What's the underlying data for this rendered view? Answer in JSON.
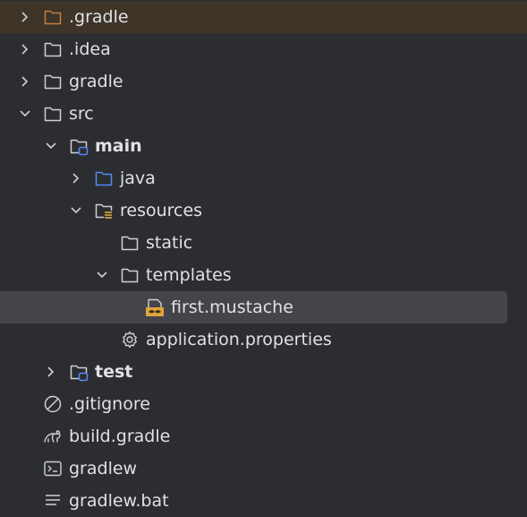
{
  "colors": {
    "background": "#2b2d30",
    "text": "#dfe1e5",
    "excluded_row_bg": "#3e3428",
    "selected_row_bg": "#43454a",
    "folder_stroke": "#ced0d6",
    "excluded_folder_stroke": "#c77d3c",
    "source_folder_stroke": "#548af7"
  },
  "tree": {
    "items": [
      {
        "label": ".gradle",
        "icon": "excluded-folder-icon",
        "expanded": false
      },
      {
        "label": ".idea",
        "icon": "folder-icon",
        "expanded": false
      },
      {
        "label": "gradle",
        "icon": "folder-icon",
        "expanded": false
      },
      {
        "label": "src",
        "icon": "folder-icon",
        "expanded": true
      },
      {
        "label": "main",
        "icon": "module-folder-icon",
        "expanded": true
      },
      {
        "label": "java",
        "icon": "source-folder-icon",
        "expanded": false
      },
      {
        "label": "resources",
        "icon": "resources-folder-icon",
        "expanded": true
      },
      {
        "label": "static",
        "icon": "folder-icon",
        "expanded": false
      },
      {
        "label": "templates",
        "icon": "folder-icon",
        "expanded": true
      },
      {
        "label": "first.mustache",
        "icon": "mustache-file-icon",
        "selected": true
      },
      {
        "label": "application.properties",
        "icon": "gear-icon"
      },
      {
        "label": "test",
        "icon": "module-folder-icon",
        "expanded": false
      },
      {
        "label": ".gitignore",
        "icon": "ignore-icon"
      },
      {
        "label": "build.gradle",
        "icon": "gradle-elephant-icon"
      },
      {
        "label": "gradlew",
        "icon": "terminal-icon"
      },
      {
        "label": "gradlew.bat",
        "icon": "text-file-icon"
      }
    ]
  }
}
